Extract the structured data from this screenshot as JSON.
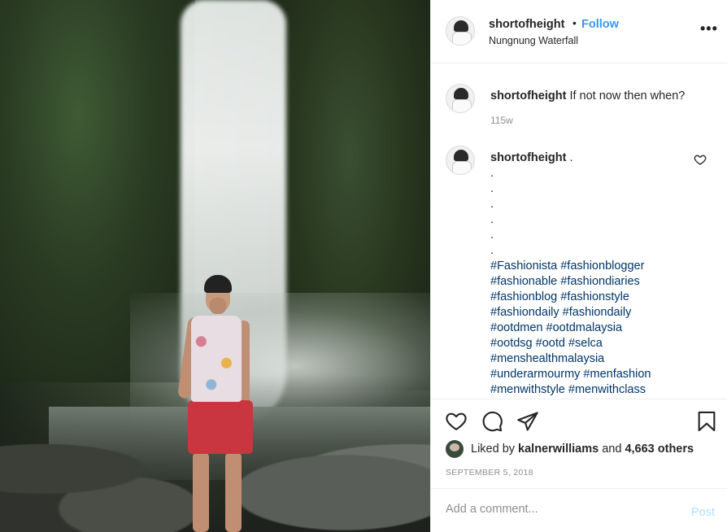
{
  "post": {
    "photo_alt": "Photo at Nungnung Waterfall",
    "author": {
      "username": "shortofheight",
      "follow_label": "Follow",
      "location": "Nungnung Waterfall"
    },
    "caption": {
      "username": "shortofheight",
      "text": "If not now then when?",
      "time": "115w"
    },
    "comment": {
      "username": "shortofheight",
      "first_line": ".",
      "dots": [
        ".",
        ".",
        ".",
        ".",
        ".",
        "."
      ],
      "hashtag_lines": [
        "#Fashionista #fashionblogger",
        "#fashionable #fashiondiaries",
        "#fashionblog #fashionstyle",
        "#fashiondaily #fashiondaily",
        "#ootdmen #ootdmalaysia",
        "#ootdsg #ootd #selca",
        "#menshealthmalaysia",
        "#underarmourmy #menfashion",
        "#menwithstyle #menwithclass"
      ]
    },
    "likes": {
      "prefix": "Liked by",
      "liker": "kalnerwilliams",
      "connector": "and",
      "others": "4,663 others"
    },
    "date": "SEPTEMBER 5, 2018",
    "add_comment": {
      "placeholder": "Add a comment...",
      "post_label": "Post"
    }
  },
  "icons": {
    "more": "more-options-icon",
    "like": "heart-icon",
    "comment": "comment-icon",
    "share": "share-icon",
    "save": "bookmark-icon",
    "comment_like": "heart-icon"
  },
  "colors": {
    "link_blue": "#3897f0",
    "hashtag": "#003569",
    "muted": "#8e8e8e",
    "post_disabled": "#b2dffc"
  }
}
